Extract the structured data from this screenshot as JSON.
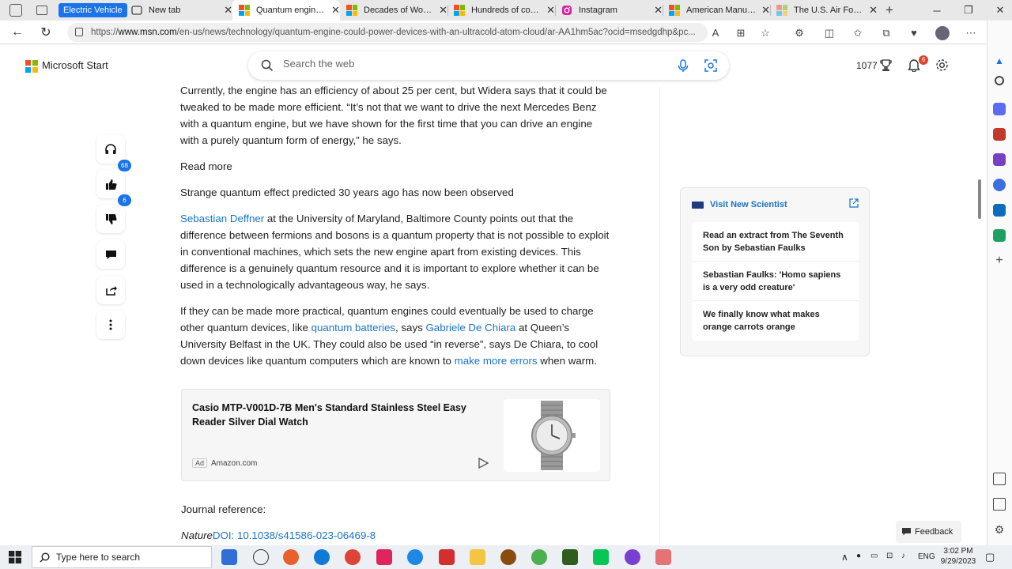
{
  "browser": {
    "tab_group_label": "Electric Vehicle",
    "tabs": [
      {
        "label": "New tab"
      },
      {
        "label": "Quantum engine could power devices with an ultracold atom cloud"
      },
      {
        "label": "Decades of Work Ended"
      },
      {
        "label": "Hundreds of consultants"
      },
      {
        "label": "Instagram"
      },
      {
        "label": "American Manufacturing"
      },
      {
        "label": "The U.S. Air Force G"
      }
    ],
    "url_prefix": "https://",
    "url_domain": "www.msn.com",
    "url_rest": "/en-us/news/technology/quantum-engine-could-power-devices-with-an-ultracold-atom-cloud/ar-AA1hm5ac?ocid=msedgdhp&pc..."
  },
  "msn": {
    "brand": "Microsoft Start",
    "search_placeholder": "Search the web",
    "points": "1077",
    "notification_count": "6"
  },
  "article": {
    "para1": "Currently, the engine has an efficiency of about 25 per cent, but Widera says that it could be tweaked to be made more efficient. “It’s not that we want to drive the next Mercedes Benz with a quantum engine, but we have shown for the first time that you can drive an engine with a purely quantum form of energy,” he says.",
    "read_more": "Read more",
    "related_headline": "Strange quantum effect predicted 30 years ago has now been observed",
    "p3_link": "Sebastian Deffner",
    "p3_text": " at the University of Maryland, Baltimore County points out that the difference between fermions and bosons is a quantum property that is not possible to exploit in conventional machines, which sets the new engine apart from existing devices. This difference is a genuinely quantum resource and it is important to explore whether it can be used in a technologically advantageous way, he says.",
    "p4_a": "If they can be made more practical, quantum engines could eventually be used to charge other quantum devices, like ",
    "p4_link1": "quantum batteries",
    "p4_b": ", says ",
    "p4_link2": "Gabriele De Chiara",
    "p4_c": " at Queen’s University Belfast in the UK. They could also be used “in reverse”, says De Chiara, to cool down devices like quantum computers which are known to ",
    "p4_link3": "make more errors",
    "p4_d": " when warm.",
    "journal_label": "Journal reference:",
    "journal_name": "Nature",
    "doi": "DOI: 10.1038/s41586-023-06469-8"
  },
  "actions": {
    "likes": "68",
    "dislikes": "6"
  },
  "ad": {
    "title": "Casio MTP-V001D-7B Men's Standard Stainless Steel Easy Reader Silver Dial Watch",
    "tag": "Ad",
    "source": "Amazon.com"
  },
  "sidebar_card": {
    "header": "Visit New Scientist",
    "items": [
      {
        "title": "Read an extract from The Seventh Son by Sebastian Faulks"
      },
      {
        "title": "Sebastian Faulks: 'Homo sapiens is a very odd creature'"
      },
      {
        "title": "We finally know what makes orange carrots orange"
      }
    ]
  },
  "feedback_label": "Feedback",
  "taskbar": {
    "search_placeholder": "Type here to search",
    "language": "ENG",
    "time": "3:02 PM",
    "date": "9/29/2023"
  },
  "colors": {
    "link": "#1a73c8",
    "accent": "#1a73e8",
    "badge_red": "#e2432a"
  }
}
